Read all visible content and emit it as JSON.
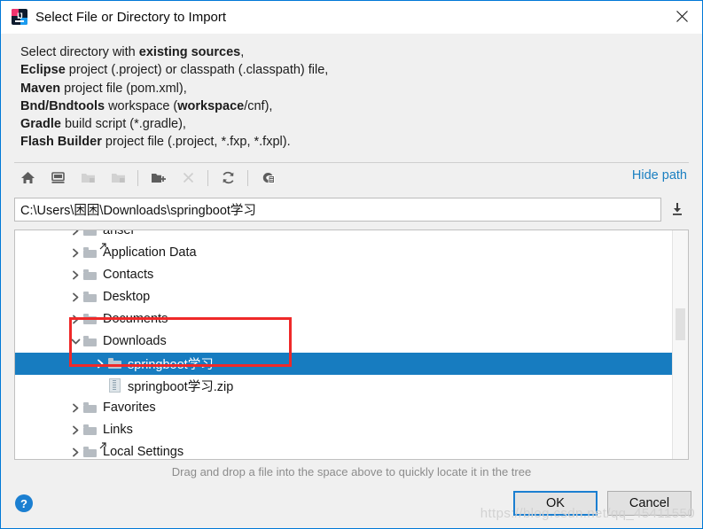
{
  "window": {
    "title": "Select File or Directory to Import",
    "app_icon": "intellij-idea-icon",
    "close_label": "✕"
  },
  "description": {
    "lines": [
      [
        {
          "t": "Select directory with ",
          "b": false
        },
        {
          "t": "existing sources",
          "b": true
        },
        {
          "t": ",",
          "b": false
        }
      ],
      [
        {
          "t": "Eclipse",
          "b": true
        },
        {
          "t": " project (.project) or classpath (.classpath) file,",
          "b": false
        }
      ],
      [
        {
          "t": "Maven",
          "b": true
        },
        {
          "t": " project file (pom.xml),",
          "b": false
        }
      ],
      [
        {
          "t": "Bnd/Bndtools",
          "b": true
        },
        {
          "t": " workspace (",
          "b": false
        },
        {
          "t": "workspace",
          "b": true
        },
        {
          "t": "/cnf),",
          "b": false
        }
      ],
      [
        {
          "t": "Gradle",
          "b": true
        },
        {
          "t": " build script (*.gradle),",
          "b": false
        }
      ],
      [
        {
          "t": "Flash Builder",
          "b": true
        },
        {
          "t": " project file (.project, *.fxp, *.fxpl).",
          "b": false
        }
      ]
    ]
  },
  "toolbar": {
    "buttons": [
      {
        "name": "home-icon",
        "enabled": true
      },
      {
        "name": "desktop-icon",
        "enabled": true
      },
      {
        "name": "project-folder-icon",
        "enabled": false
      },
      {
        "name": "module-folder-icon",
        "enabled": false
      },
      {
        "name": "new-folder-icon",
        "enabled": true
      },
      {
        "name": "delete-icon",
        "enabled": false
      },
      {
        "name": "refresh-icon",
        "enabled": true
      },
      {
        "name": "show-hidden-files-icon",
        "enabled": true
      }
    ],
    "hide_path_label": "Hide path"
  },
  "path_field": {
    "value": "C:\\Users\\困困\\Downloads\\springboot学习",
    "placeholder": "",
    "download_icon": "drop-down-history-icon"
  },
  "tree": {
    "items": [
      {
        "label": "anser",
        "icon": "folder",
        "expander": "collapsed",
        "indent": 1,
        "selected": false,
        "clipped": true
      },
      {
        "label": "Application Data",
        "icon": "folder-shortcut",
        "expander": "collapsed",
        "indent": 1,
        "selected": false
      },
      {
        "label": "Contacts",
        "icon": "folder",
        "expander": "collapsed",
        "indent": 1,
        "selected": false
      },
      {
        "label": "Desktop",
        "icon": "folder",
        "expander": "collapsed",
        "indent": 1,
        "selected": false
      },
      {
        "label": "Documents",
        "icon": "folder",
        "expander": "collapsed",
        "indent": 1,
        "selected": false
      },
      {
        "label": "Downloads",
        "icon": "folder",
        "expander": "expanded",
        "indent": 1,
        "selected": false
      },
      {
        "label": "springboot学习",
        "icon": "folder",
        "expander": "collapsed",
        "indent": 2,
        "selected": true
      },
      {
        "label": "springboot学习.zip",
        "icon": "zip",
        "expander": "none",
        "indent": 2,
        "selected": false
      },
      {
        "label": "Favorites",
        "icon": "folder",
        "expander": "collapsed",
        "indent": 1,
        "selected": false
      },
      {
        "label": "Links",
        "icon": "folder",
        "expander": "collapsed",
        "indent": 1,
        "selected": false
      },
      {
        "label": "Local Settings",
        "icon": "folder-shortcut",
        "expander": "collapsed",
        "indent": 1,
        "selected": false
      }
    ],
    "selection_color": "#177cc0",
    "annotation_color": "#ef2929"
  },
  "footer": {
    "hint": "Drag and drop a file into the space above to quickly locate it in the tree",
    "help_label": "?",
    "ok_label": "OK",
    "cancel_label": "Cancel"
  },
  "watermark": "https://blog.csdn.net/qq_45411550"
}
